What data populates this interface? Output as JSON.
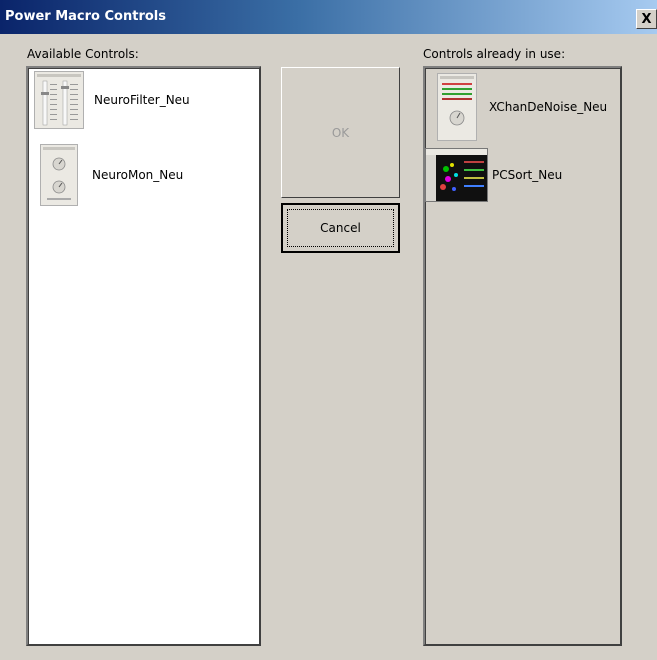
{
  "window": {
    "title": "Power Macro Controls",
    "close_label": "X"
  },
  "available": {
    "label": "Available Controls:",
    "items": [
      {
        "name": "NeuroFilter_Neu",
        "icon": "neurofilter-thumbnail-icon"
      },
      {
        "name": "NeuroMon_Neu",
        "icon": "neuromon-thumbnail-icon"
      }
    ]
  },
  "in_use": {
    "label": "Controls already in use:",
    "items": [
      {
        "name": "XChanDeNoise_Neu",
        "icon": "xchandenoise-thumbnail-icon"
      },
      {
        "name": "PCSort_Neu",
        "icon": "pcsort-thumbnail-icon"
      }
    ]
  },
  "buttons": {
    "ok": "OK",
    "cancel": "Cancel"
  },
  "colors": {
    "face": "#d4d0c8",
    "title_start": "#0a246a",
    "title_end": "#a6caf0",
    "disabled_text": "#9a9a9a"
  }
}
